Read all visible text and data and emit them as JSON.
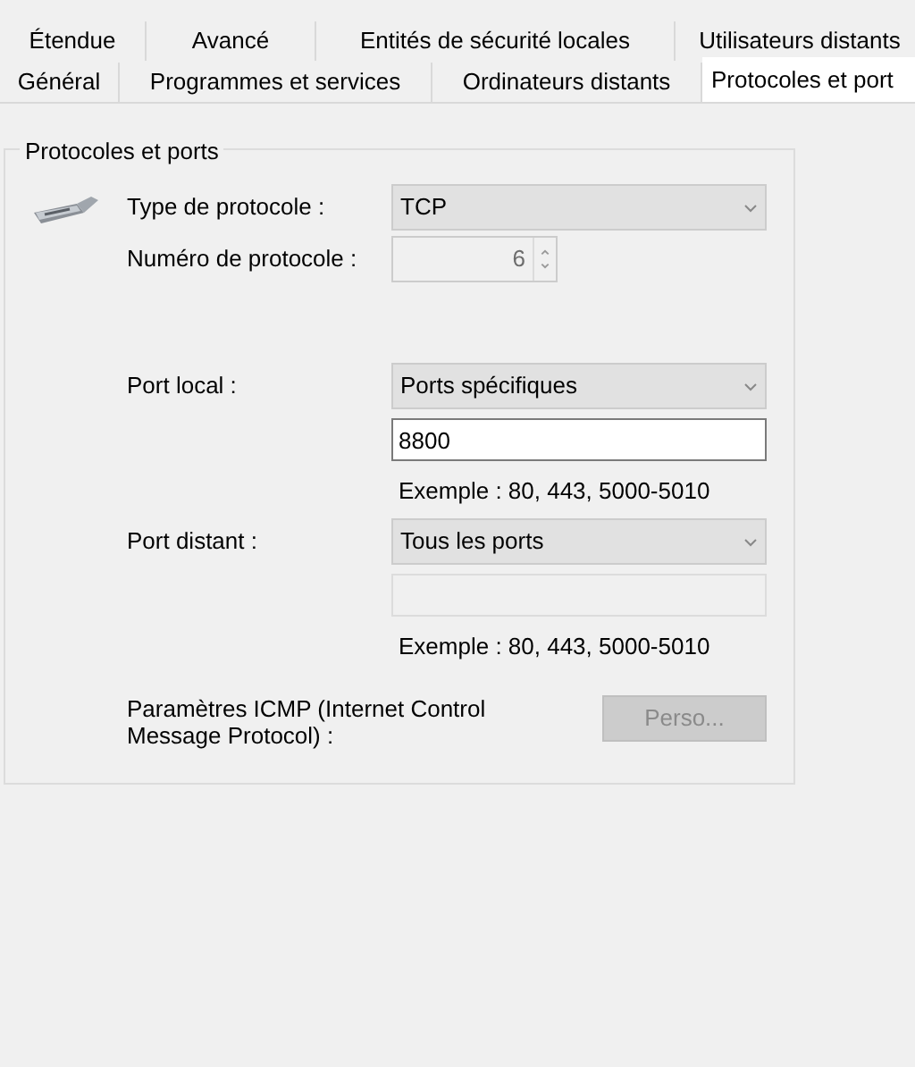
{
  "tabs_row_1": [
    {
      "label": "Étendue",
      "selected": false
    },
    {
      "label": "Avancé",
      "selected": false
    },
    {
      "label": "Entités de sécurité locales",
      "selected": false
    },
    {
      "label": "Utilisateurs distants",
      "selected": false
    }
  ],
  "tabs_row_2": [
    {
      "label": "Général",
      "selected": false
    },
    {
      "label": "Programmes et services",
      "selected": false
    },
    {
      "label": "Ordinateurs distants",
      "selected": false
    },
    {
      "label": "Protocoles et port",
      "selected": true
    }
  ],
  "group": {
    "title": "Protocoles et ports",
    "protocol_type": {
      "label": "Type de protocole :",
      "value": "TCP"
    },
    "protocol_number": {
      "label": "Numéro de protocole :",
      "value": "6",
      "disabled": true
    },
    "local_port": {
      "label": "Port local :",
      "value": "Ports spécifiques",
      "input": "8800",
      "input_disabled": false,
      "example": "Exemple : 80, 443, 5000-5010"
    },
    "remote_port": {
      "label": "Port distant :",
      "value": "Tous les ports",
      "input_disabled": true,
      "example": "Exemple : 80, 443, 5000-5010"
    },
    "icmp": {
      "label": "Paramètres ICMP (Internet Control Message Protocol) :",
      "button": "Perso...",
      "disabled": true
    }
  }
}
